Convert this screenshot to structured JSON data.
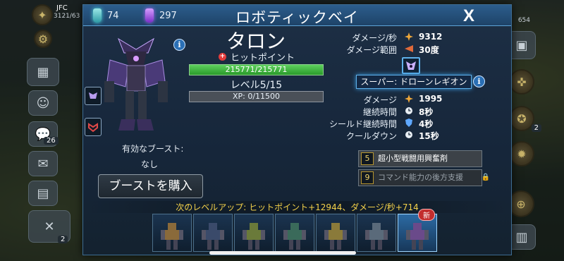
{
  "header": {
    "title": "ロボティックベイ",
    "teal_count": "74",
    "purple_count": "297",
    "close_label": "X"
  },
  "hud": {
    "player_tag": "JFC",
    "player_resource": "3121/63",
    "badge_26": "26",
    "badge_2_left": "2",
    "badge_2_right": "2",
    "top_right_value": "654"
  },
  "robot": {
    "name": "タロン",
    "hp_label": "ヒットポイント",
    "hp_text": "215771/215771",
    "hp_fraction": 1.0,
    "level": "レベル5/15",
    "xp_text": "XP: 0/11500",
    "xp_fraction": 0.0,
    "boost_label": "有効なブースト:",
    "boost_value": "なし",
    "buy_boost": "ブーストを購入"
  },
  "stats": {
    "dps_label": "ダメージ/秒",
    "dps_value": "9312",
    "range_label": "ダメージ範囲",
    "range_value": "30度"
  },
  "super": {
    "name": "スーパー: ドローンレギオン",
    "damage_label": "ダメージ",
    "damage_value": "1995",
    "duration_label": "継続時間",
    "duration_value": "8秒",
    "shield_label": "シールド継続時間",
    "shield_value": "4秒",
    "cooldown_label": "クールダウン",
    "cooldown_value": "15秒"
  },
  "items": [
    {
      "num": "5",
      "label": "超小型戦闘用興奮剤"
    },
    {
      "num": "9",
      "label": "コマンド能力の後方支援"
    }
  ],
  "next_level": "次のレベルアップ: ヒットポイント+12944、ダメージ/秒+714",
  "roster": {
    "new_badge": "新",
    "colors": [
      "#8a6a3a",
      "#3a4a6a",
      "#6a7a3a",
      "#3a6a5a",
      "#8a7a3a",
      "#5a6a7a",
      "#6a4a8a"
    ]
  }
}
